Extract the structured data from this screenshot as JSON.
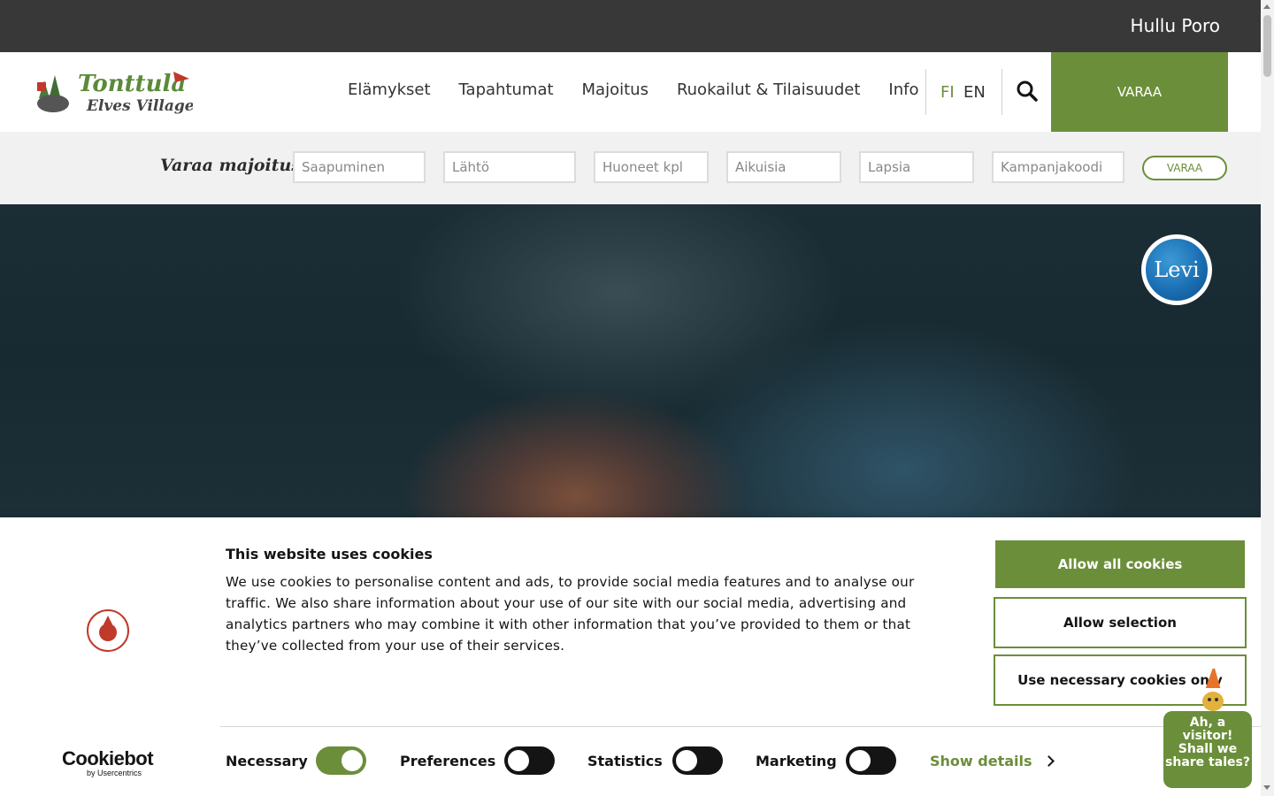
{
  "topbar": {
    "link": "Hullu Poro"
  },
  "header": {
    "logo_alt": "Tonttula Elves Village",
    "nav": [
      "Elämykset",
      "Tapahtumat",
      "Majoitus",
      "Ruokailut & Tilaisuudet",
      "Info"
    ],
    "lang_fi": "FI",
    "lang_en": "EN",
    "book_label": "VARAA"
  },
  "booking": {
    "title": "Varaa majoitus",
    "arrival": "Saapuminen",
    "departure": "Lähtö",
    "rooms": "Huoneet kpl",
    "adults": "Aikuisia",
    "children": "Lapsia",
    "campaign": "Kampanjakoodi",
    "submit": "VARAA"
  },
  "hero": {
    "badge": "Levi"
  },
  "cookie": {
    "title": "This website uses cookies",
    "text": "We use cookies to personalise content and ads, to provide social media features and to analyse our traffic. We also share information about your use of our site with our social media, advertising and analytics partners who may combine it with other information that you’ve provided to them or that they’ve collected from your use of their services.",
    "allow_all": "Allow all cookies",
    "allow_selection": "Allow selection",
    "necessary_only": "Use necessary cookies only",
    "toggles": [
      {
        "label": "Necessary",
        "on": true
      },
      {
        "label": "Preferences",
        "on": false
      },
      {
        "label": "Statistics",
        "on": false
      },
      {
        "label": "Marketing",
        "on": false
      }
    ],
    "show_details": "Show details",
    "cookiebot_name": "Cookiebot",
    "cookiebot_sub": "by Usercentrics"
  },
  "chat": {
    "text": "Ah, a visitor! Shall we share tales?"
  },
  "colors": {
    "accent": "#6b8e3a",
    "topbar": "#383838"
  }
}
